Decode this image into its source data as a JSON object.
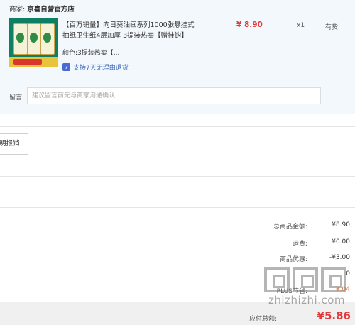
{
  "seller": {
    "label": "商家:",
    "name": "京喜自营官方店"
  },
  "product": {
    "image_icon": "tissue-pack-image",
    "title": "【百万销量】向日葵油画系列1000张悬挂式抽纸卫生纸4层加厚 3提装热卖【赠挂钩】",
    "price": "¥ 8.90",
    "quantity": "x1",
    "stock": "有货",
    "color_label": "颜色:",
    "color_value": "3提装热卖【...",
    "return_icon": "return-policy-icon",
    "return_icon_glyph": "7",
    "return_text": "支持7天无理由退货"
  },
  "message": {
    "label": "留言:",
    "placeholder": "建议留言前先与商家沟通确认"
  },
  "invoice": {
    "button_label": "明报销"
  },
  "summary": {
    "rows": [
      {
        "label": "总商品金额:",
        "value": "¥8.90"
      },
      {
        "label": "运费:",
        "value": "¥0.00"
      },
      {
        "label": "商品优惠:",
        "value": "-¥3.00"
      },
      {
        "label": "",
        "value": "0"
      },
      {
        "label": "PLUS节省:",
        "value": "¥.04"
      }
    ],
    "total_label": "应付总额:",
    "total_value": "¥5.86"
  },
  "watermark": {
    "logo_icon": "zhizhizhi-logo",
    "text": "zhizhizhi.com"
  },
  "colors": {
    "price_red": "#e23a3a",
    "total_red": "#e4393c",
    "link_blue": "#3a66b8",
    "panel_bg": "#f3f8fd"
  }
}
